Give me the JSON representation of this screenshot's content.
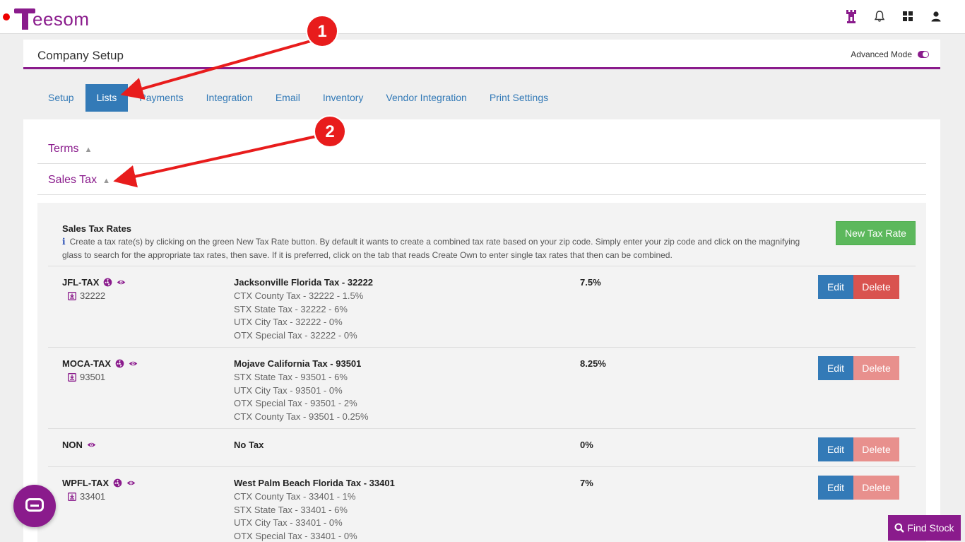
{
  "brand": {
    "name": "eesom",
    "color": "#8a1b8c"
  },
  "header": {
    "icons": [
      "tower-icon",
      "bell-icon",
      "grid-icon",
      "user-icon"
    ]
  },
  "setup": {
    "title": "Company Setup",
    "advanced_mode_label": "Advanced Mode",
    "advanced_mode_on": true
  },
  "tabs": [
    {
      "label": "Setup",
      "active": false
    },
    {
      "label": "Lists",
      "active": true
    },
    {
      "label": "Payments",
      "active": false
    },
    {
      "label": "Integration",
      "active": false
    },
    {
      "label": "Email",
      "active": false
    },
    {
      "label": "Inventory",
      "active": false
    },
    {
      "label": "Vendor Integration",
      "active": false
    },
    {
      "label": "Print Settings",
      "active": false
    }
  ],
  "accordions": {
    "terms": "Terms",
    "sales_tax": "Sales Tax"
  },
  "sales_tax": {
    "heading": "Sales Tax Rates",
    "info_glyph": "i",
    "description": "Create a tax rate(s) by clicking on the green New Tax Rate button. By default it wants to create a combined tax rate based on your zip code. Simply enter your zip code and click on the magnifying glass to search for the appropriate tax rates, then save. If it is preferred, click on the tab that reads Create Own to enter single tax rates that then can be combined.",
    "new_button": "New Tax Rate",
    "edit_label": "Edit",
    "delete_label": "Delete",
    "rows": [
      {
        "code": "JFL-TAX",
        "zip": "32222",
        "name": "Jacksonville Florida Tax - 32222",
        "components": [
          "CTX County Tax - 32222 - 1.5%",
          "STX State Tax - 32222 - 6%",
          "UTX City Tax - 32222 - 0%",
          "OTX Special Tax - 32222 - 0%"
        ],
        "rate": "7.5%"
      },
      {
        "code": "MOCA-TAX",
        "zip": "93501",
        "name": "Mojave California Tax - 93501",
        "components": [
          "STX State Tax - 93501 - 6%",
          "UTX City Tax - 93501 - 0%",
          "OTX Special Tax - 93501 - 2%",
          "CTX County Tax - 93501 - 0.25%"
        ],
        "rate": "8.25%"
      },
      {
        "code": "NON",
        "zip": "",
        "name": "No Tax",
        "components": [],
        "rate": "0%"
      },
      {
        "code": "WPFL-TAX",
        "zip": "33401",
        "name": "West Palm Beach Florida Tax - 33401",
        "components": [
          "CTX County Tax - 33401 - 1%",
          "STX State Tax - 33401 - 6%",
          "UTX City Tax - 33401 - 0%",
          "OTX Special Tax - 33401 - 0%"
        ],
        "rate": "7%"
      }
    ]
  },
  "callouts": [
    "1",
    "2"
  ],
  "find_stock": "Find Stock",
  "colors": {
    "primary": "#337ab7",
    "success": "#5cb85c",
    "danger": "#d9534f",
    "accent": "#8a1b8c",
    "callout": "#e81c1c"
  }
}
